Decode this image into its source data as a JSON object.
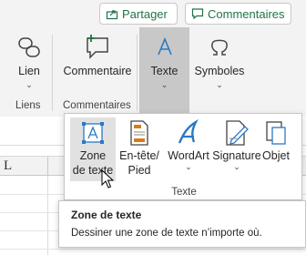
{
  "header": {
    "share_label": "Partager",
    "comments_label": "Commentaires"
  },
  "ribbon": {
    "buttons": [
      {
        "label": "Lien",
        "icon": "link-icon"
      },
      {
        "label": "Commentaire",
        "icon": "comment-icon"
      },
      {
        "label": "Texte",
        "icon": "text-icon"
      },
      {
        "label": "Symboles",
        "icon": "omega-icon"
      }
    ],
    "groups": [
      "Liens",
      "Commentaires"
    ]
  },
  "sheet": {
    "column_label": "L"
  },
  "text_dropdown": {
    "items": [
      {
        "label_line1": "Zone",
        "label_line2": "de texte",
        "icon": "text-box-icon"
      },
      {
        "label_line1": "En-tête/",
        "label_line2": "Pied",
        "icon": "header-footer-icon"
      },
      {
        "label_line1": "WordArt",
        "icon": "wordart-icon"
      },
      {
        "label_line1": "Signature",
        "icon": "signature-pen-icon"
      },
      {
        "label_line1": "Objet",
        "icon": "object-icon"
      }
    ],
    "group_label": "Texte"
  },
  "tooltip": {
    "title": "Zone de texte",
    "description": "Dessiner une zone de texte n’importe où."
  },
  "colors": {
    "accent_green": "#217346",
    "icon_blue": "#2b79c2",
    "icon_orange": "#d87a16",
    "ribbon_bg": "#f3f3f3",
    "selected_bg": "#c8c8c8"
  }
}
